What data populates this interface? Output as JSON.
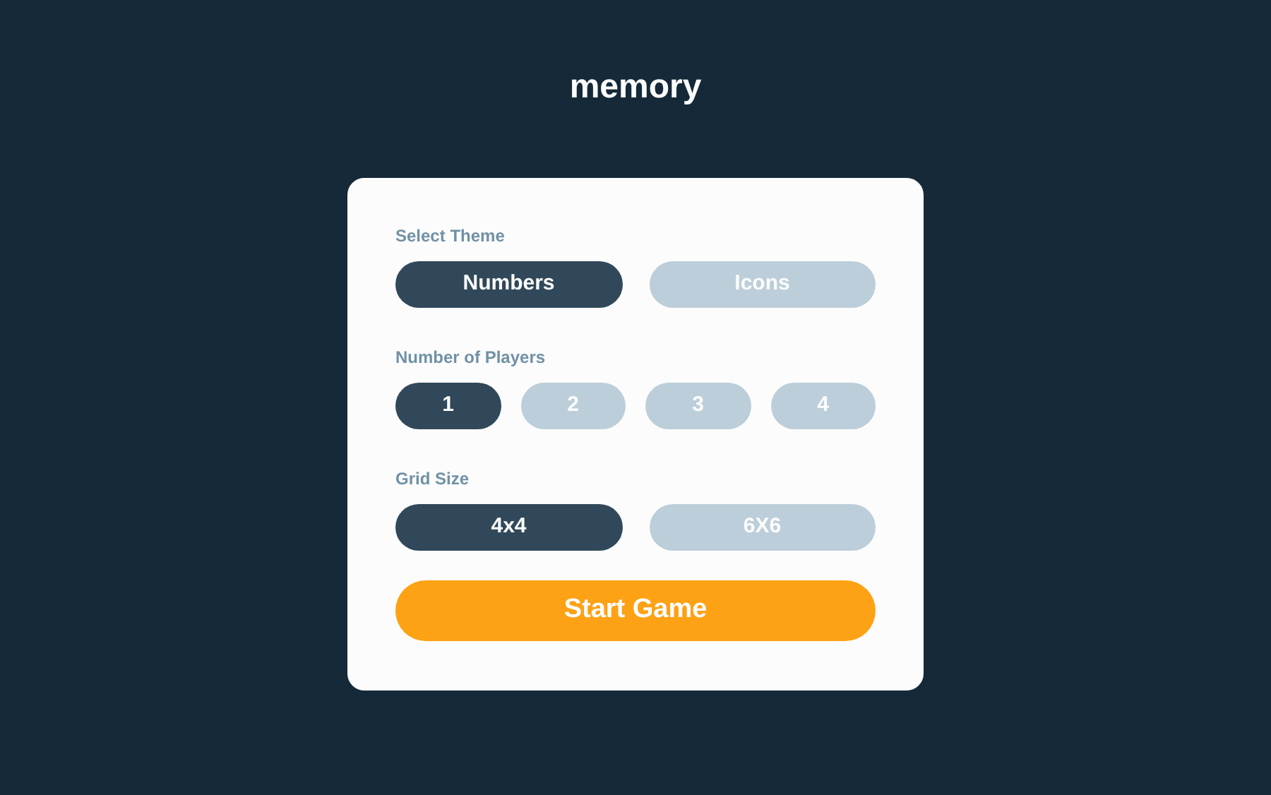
{
  "title": "memory",
  "sections": [
    {
      "label": "Select Theme",
      "options": [
        {
          "label": "Numbers",
          "selected": true
        },
        {
          "label": "Icons",
          "selected": false
        }
      ]
    },
    {
      "label": "Number of Players",
      "options": [
        {
          "label": "1",
          "selected": true
        },
        {
          "label": "2",
          "selected": false
        },
        {
          "label": "3",
          "selected": false
        },
        {
          "label": "4",
          "selected": false
        }
      ]
    },
    {
      "label": "Grid Size",
      "options": [
        {
          "label": "4x4",
          "selected": true
        },
        {
          "label": "6X6",
          "selected": false
        }
      ]
    }
  ],
  "start_button": "Start Game"
}
